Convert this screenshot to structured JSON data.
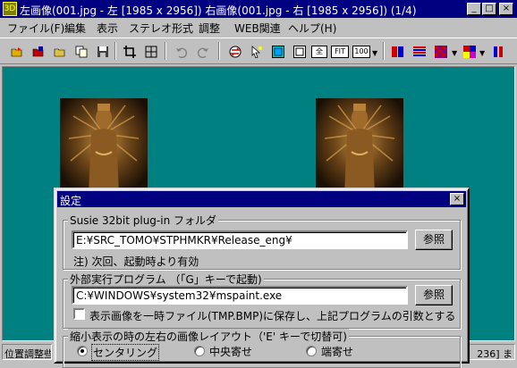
{
  "window": {
    "title": "左画像(001.jpg - 左 [1985 x 2956]) 右画像(001.jpg - 右 [1985 x 2956])  (1/4)",
    "icon_label": "3D",
    "controls": {
      "minimize": "_",
      "maximize": "□",
      "close": "×"
    }
  },
  "menu": [
    "ファイル(F)",
    "編集",
    "表示",
    "ステレオ形式",
    "調整",
    "WEB関連",
    "ヘルプ(H)"
  ],
  "toolbar": {
    "icons": [
      "open-folder-icon",
      "open-pair-icon",
      "open-file-icon",
      "copy-icon",
      "save-icon",
      "crop-icon",
      "move-icon",
      "undo-icon",
      "redo-icon",
      "swap-icon",
      "cursor-icon",
      "fit-frame-icon",
      "frame-icon",
      "full-icon",
      "fit-icon",
      "zoom-100-icon",
      "stereo-color-icon",
      "interlace-icon",
      "checker-icon",
      "palette-icon",
      "split-icon"
    ],
    "labels": {
      "full": "全",
      "fit": "FIT",
      "zoom": "100"
    }
  },
  "status": {
    "left": "位置調整些",
    "right": "236] ま"
  },
  "dialog": {
    "title": "設定",
    "close": "×",
    "susie": {
      "legend": "Susie 32bit plug-in フォルダ",
      "path": "E:¥SRC_TOMO¥STPHMKR¥Release_eng¥",
      "browse": "参照",
      "note": "注) 次回、起動時より有効"
    },
    "external": {
      "legend": "外部実行プログラム （「G」キーで起動)",
      "path": "C:¥WINDOWS¥system32¥mspaint.exe",
      "browse": "参照",
      "checkbox_label": "表示画像を一時ファイル(TMP.BMP)に保存し、上記プログラムの引数とする",
      "checked": false
    },
    "layout": {
      "legend": "縮小表示の時の左右の画像レイアウト（'E' キーで切替可)",
      "options": [
        "センタリング",
        "中央寄せ",
        "端寄せ"
      ],
      "selected": "センタリング"
    }
  },
  "colors": {
    "titlebar": "#000080",
    "workspace": "#008080",
    "face": "#c0c0c0"
  }
}
